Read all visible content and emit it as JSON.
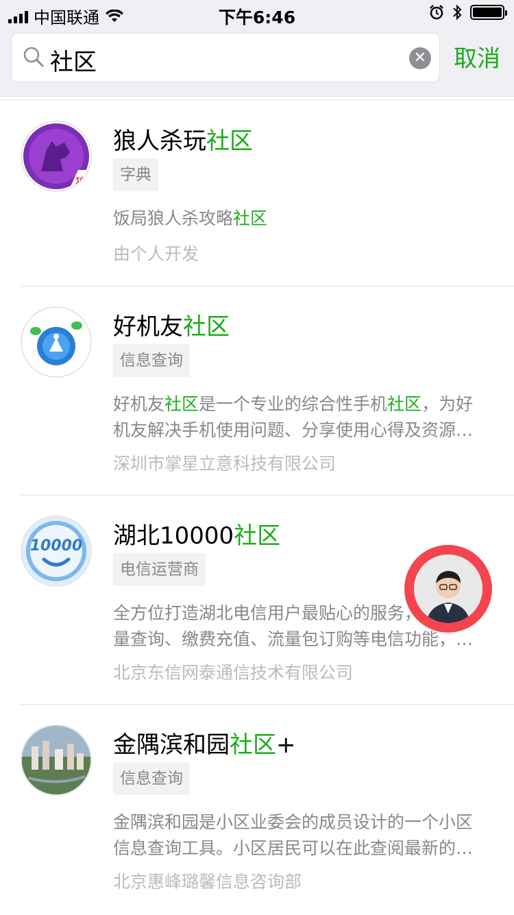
{
  "status_bar": {
    "carrier": "中国联通",
    "time": "下午6:46"
  },
  "search": {
    "query": "社区",
    "cancel_label": "取消"
  },
  "results": [
    {
      "name_prefix": "狼人杀玩",
      "name_highlight": "社区",
      "name_suffix": "",
      "tag": "字典",
      "desc_lines": [
        [
          "饭局狼人杀攻略",
          "社区",
          ""
        ]
      ],
      "developer": "由个人开发",
      "avatar_icon": "werewolf-icon",
      "avatar_badge": "狼"
    },
    {
      "name_prefix": "好机友",
      "name_highlight": "社区",
      "name_suffix": "",
      "tag": "信息查询",
      "desc_lines": [
        [
          "好机友",
          "社区",
          "是一个专业的综合性手机",
          "社区",
          "，为好"
        ],
        [
          "机友解决手机使用问题、分享使用心得及资源…"
        ]
      ],
      "developer": "深圳市掌星立意科技有限公司",
      "avatar_icon": "camera-aperture-icon"
    },
    {
      "name_prefix": "湖北10000",
      "name_highlight": "社区",
      "name_suffix": "",
      "tag": "电信运营商",
      "desc_lines": [
        [
          "全方位打造湖北电信用户最贴心的服务，话费流"
        ],
        [
          "量查询、缴费充值、流量包订购等电信功能，…"
        ]
      ],
      "developer": "北京东信网泰通信技术有限公司",
      "avatar_icon": "telecom-10000-icon",
      "avatar_text": "10000"
    },
    {
      "name_prefix": "金隅滨和园",
      "name_highlight": "社区",
      "name_suffix": "+",
      "tag": "信息查询",
      "desc_lines": [
        [
          "金隅滨和园是小区业委会的成员设计的一个小区"
        ],
        [
          "信息查询工具。小区居民可以在此查阅最新的…"
        ]
      ],
      "developer": "北京惠峰璐馨信息咨询部",
      "avatar_icon": "residential-aerial-icon"
    }
  ],
  "colors": {
    "accent": "#1aad19",
    "muted": "#888888",
    "light": "#bbbbbb",
    "bubble": "#f4454f"
  }
}
